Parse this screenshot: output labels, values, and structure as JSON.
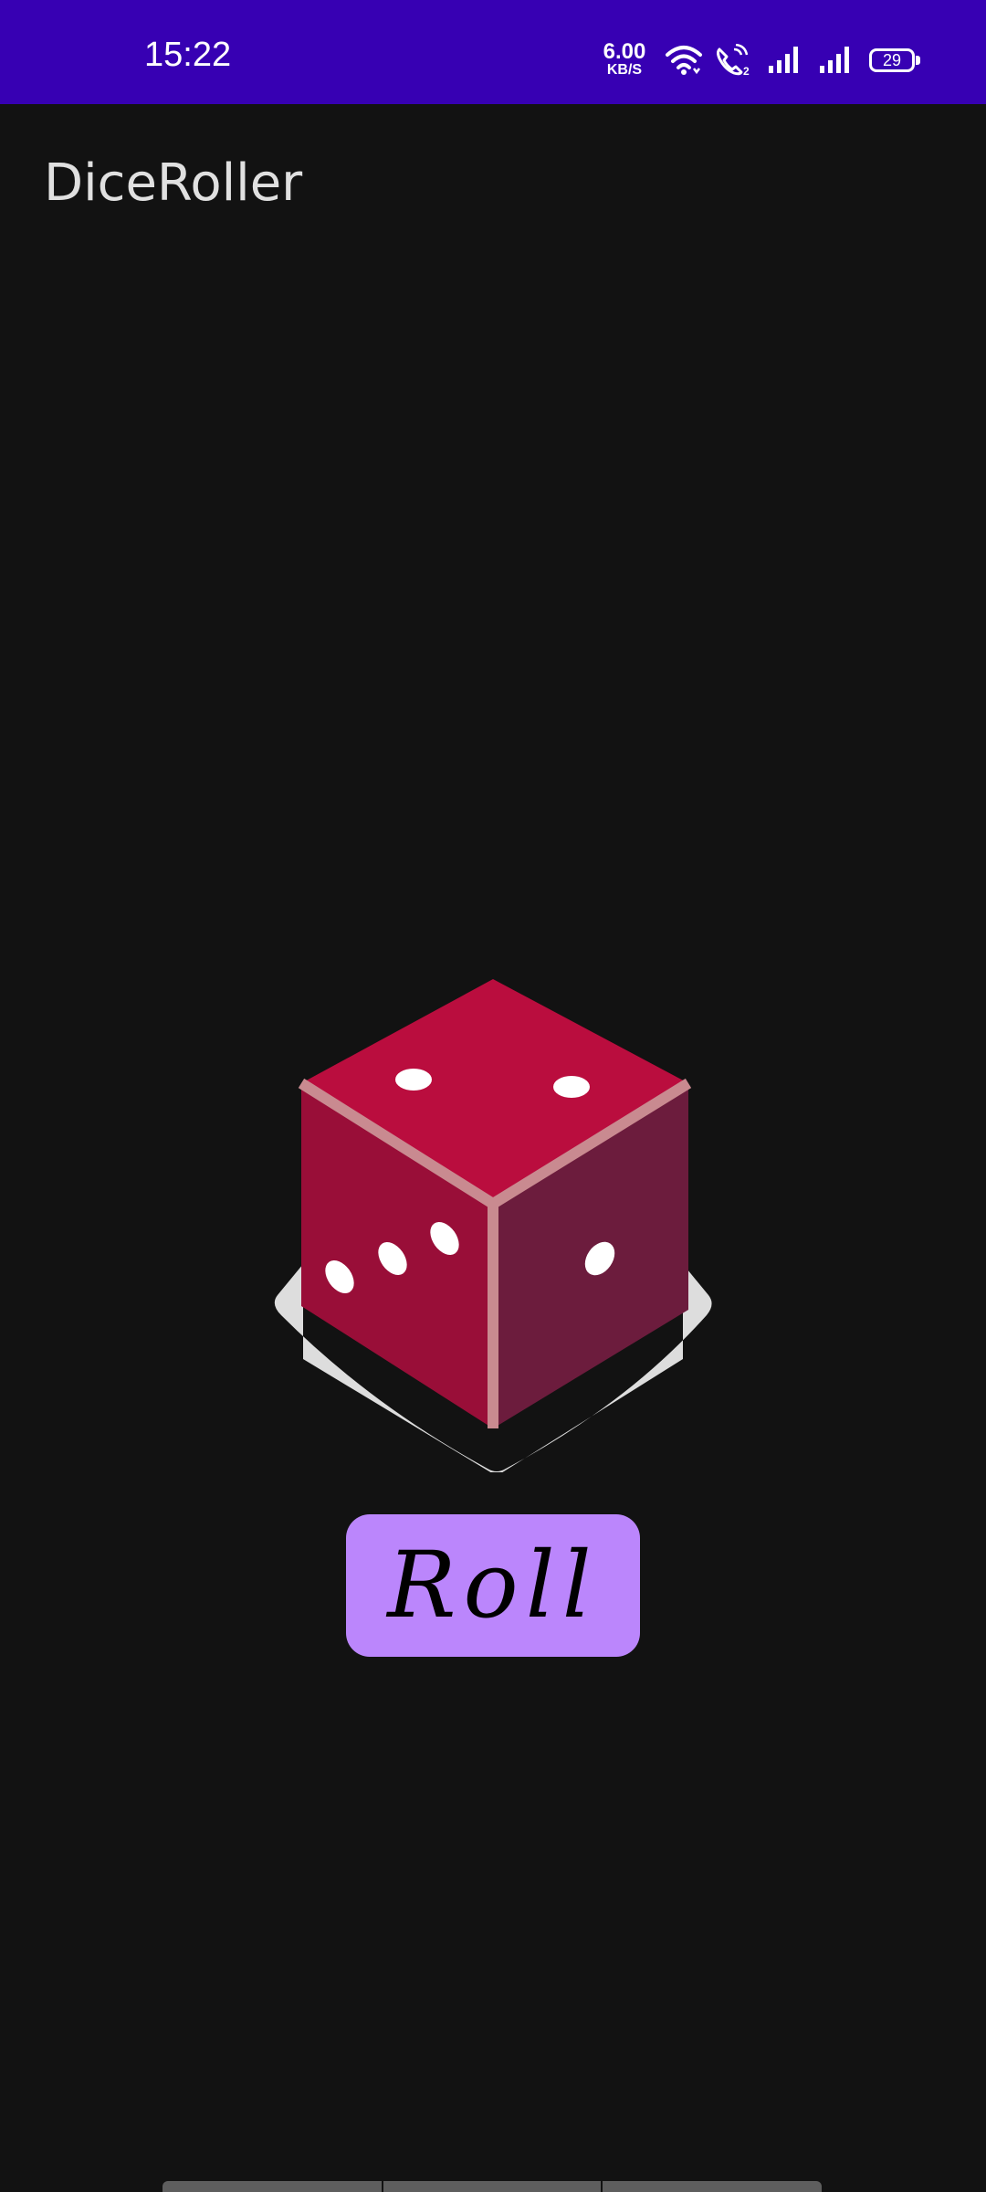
{
  "status_bar": {
    "time": "15:22",
    "speed_value": "6.00",
    "speed_unit": "KB/S",
    "battery_level": "29",
    "background": "#3700b3",
    "icons": [
      "wifi-icon",
      "volte-call-icon",
      "signal-sim1-icon",
      "signal-sim2-icon",
      "battery-icon"
    ]
  },
  "app": {
    "title": "DiceRoller"
  },
  "dice": {
    "top_face_pips": 2,
    "left_face_pips": 3,
    "right_face_pips": 1,
    "colors": {
      "top": "#ba0d3e",
      "left": "#990e38",
      "right": "#6c1c3d",
      "edge": "#c98a90",
      "shadow": "#dddddd",
      "pip": "#ffffff"
    }
  },
  "roll_button": {
    "label": "Roll",
    "color": "#bb86fc"
  }
}
